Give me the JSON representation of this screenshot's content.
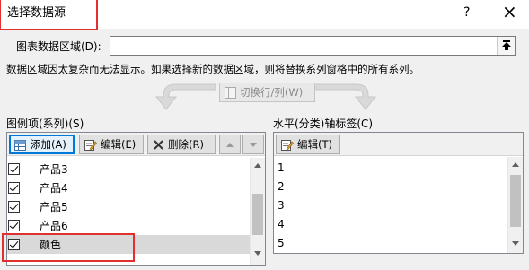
{
  "window": {
    "title": "选择数据源",
    "help_label": "?",
    "close_label": "×"
  },
  "chart_range": {
    "label": "图表数据区域(D):",
    "value": ""
  },
  "message": "数据区域因太复杂而无法显示。如果选择新的数据区域，则将替换系列窗格中的所有系列。",
  "switch_button": "切换行/列(W)",
  "legend_panel": {
    "title": "图例项(系列)(S)",
    "add_label": "添加(A)",
    "edit_label": "编辑(E)",
    "delete_label": "删除(R)",
    "items": [
      {
        "label": "产品3",
        "checked": true
      },
      {
        "label": "产品4",
        "checked": true
      },
      {
        "label": "产品5",
        "checked": true
      },
      {
        "label": "产品6",
        "checked": true
      },
      {
        "label": "颜色",
        "checked": true
      }
    ]
  },
  "axis_panel": {
    "title": "水平(分类)轴标签(C)",
    "edit_label": "编辑(T)",
    "items": [
      "1",
      "2",
      "3",
      "4",
      "5"
    ]
  }
}
